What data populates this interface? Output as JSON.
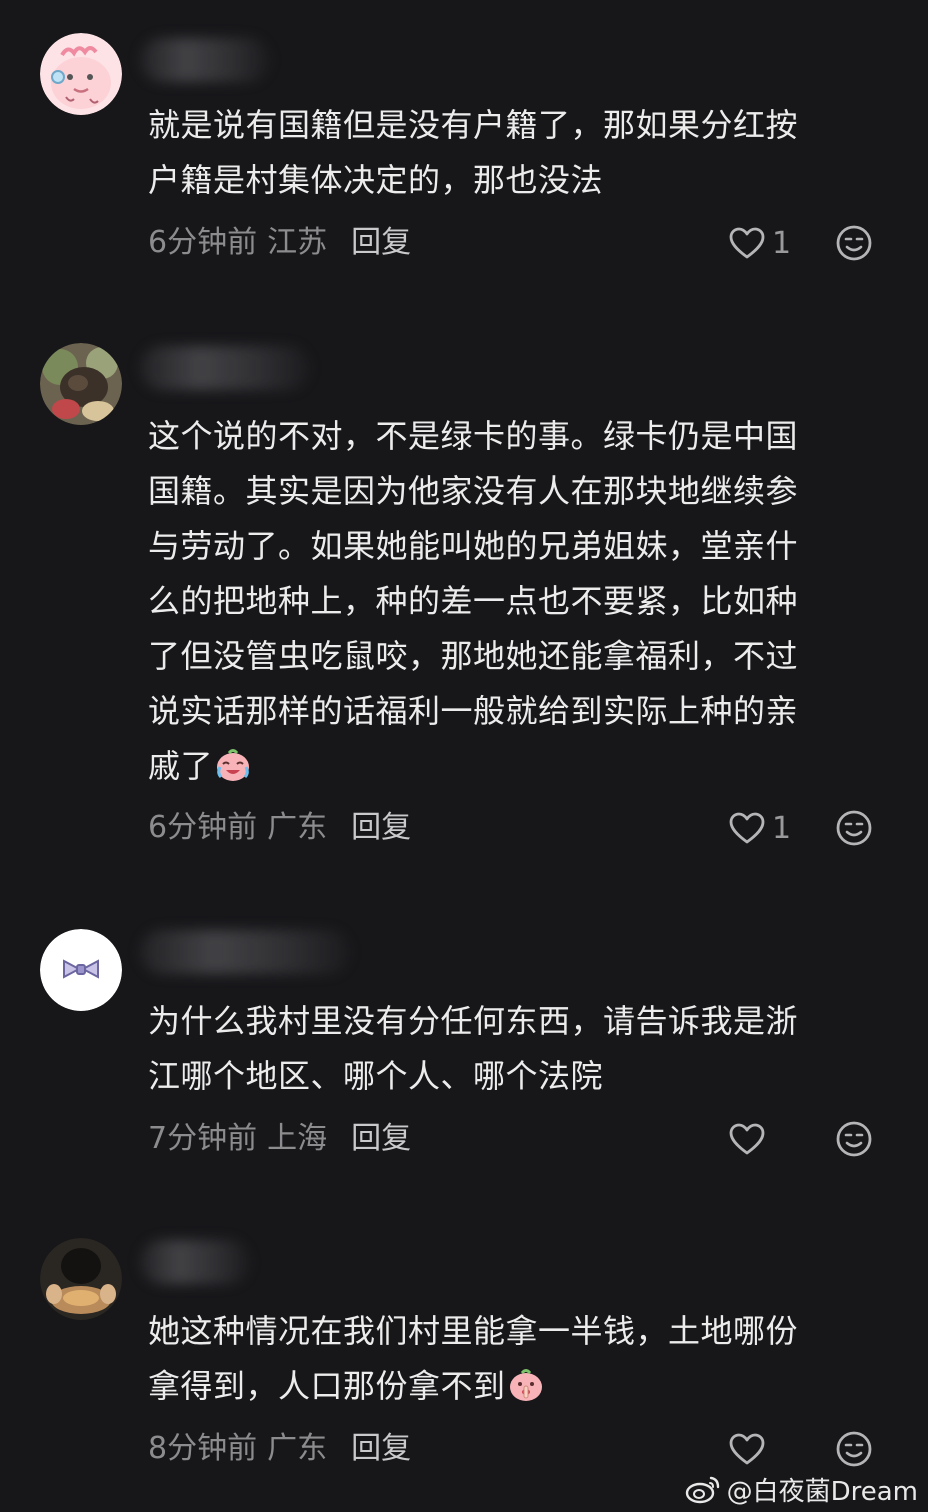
{
  "comments": [
    {
      "avatar": "pink-cartoon-avatar",
      "lines": [
        "就是说有国籍但是没有户籍了，那如果分红按",
        "户籍是村集体决定的，那也没法"
      ],
      "time": "6分钟前",
      "location": "江苏",
      "reply_label": "回复",
      "likes": "1"
    },
    {
      "avatar": "photo-avatar",
      "lines": [
        "这个说的不对，不是绿卡的事。绿卡仍是中国",
        "国籍。其实是因为他家没有人在那块地继续参",
        "与劳动了。如果她能叫她的兄弟姐妹，堂亲什",
        "么的把地种上，种的差一点也不要紧，比如种",
        "了但没管虫吃鼠咬，那地她还能拿福利，不过",
        "说实话那样的话福利一般就给到实际上种的亲",
        "戚了"
      ],
      "emoji": "crying-laughing-emoji",
      "time": "6分钟前",
      "location": "广东",
      "reply_label": "回复",
      "likes": "1"
    },
    {
      "avatar": "bow-avatar",
      "lines": [
        "为什么我村里没有分任何东西，请告诉我是浙",
        "江哪个地区、哪个人、哪个法院"
      ],
      "time": "7分钟前",
      "location": "上海",
      "reply_label": "回复",
      "likes": ""
    },
    {
      "avatar": "dark-photo-avatar",
      "lines": [
        "她这种情况在我们村里能拿一半钱，土地哪份",
        "拿得到，人口那份拿不到"
      ],
      "emoji": "shushing-emoji",
      "time": "8分钟前",
      "location": "广东",
      "reply_label": "回复",
      "likes": ""
    }
  ],
  "icons": {
    "like": "heart-outline-icon",
    "emoji_react": "smiley-face-icon",
    "watermark_logo": "weibo-logo-icon"
  },
  "watermark": {
    "text": "@白夜菌Dream"
  },
  "colors": {
    "background": "#17171a",
    "text": "#ececec",
    "meta": "#8c8c8f"
  }
}
